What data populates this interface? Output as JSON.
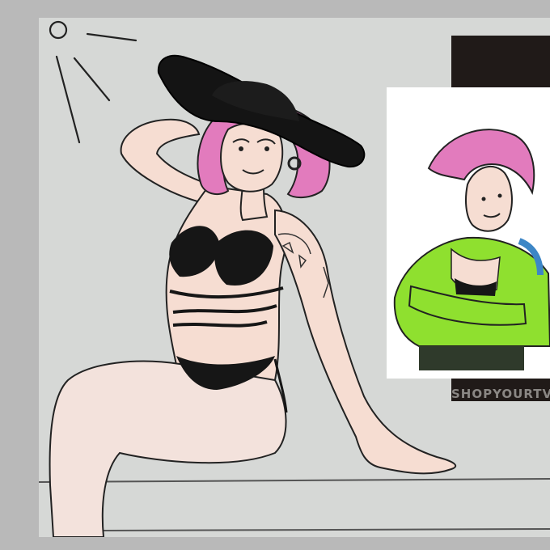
{
  "image": {
    "watermark_text": "SHOPYOURTV"
  },
  "colors": {
    "frame": "#b9b9b9",
    "canvas": "#d6d8d6",
    "skin": "#f6ddd2",
    "hair": "#e27bbd",
    "hat": "#141414",
    "bikini": "#161616",
    "jacket": "#8fe02f",
    "ink": "#222222"
  },
  "icons": [
    "sun-doodle"
  ]
}
